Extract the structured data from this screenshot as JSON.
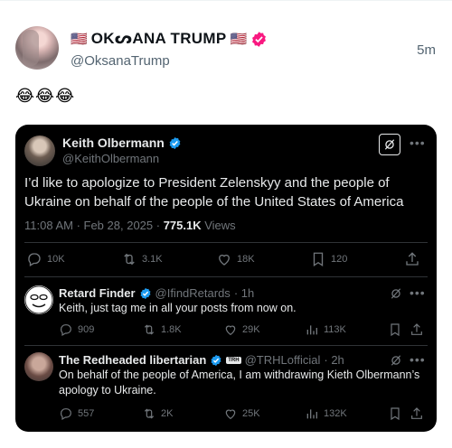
{
  "post": {
    "display_name": "OKᔕANA TRUMP",
    "flag": "🇺🇸",
    "handle": "@OksanaTrump",
    "time": "5m",
    "text": "😂😂😂"
  },
  "quote": {
    "name": "Keith Olbermann",
    "handle": "@KeithOlbermann",
    "text": "I’d like to apologize to President Zelenskyy and the people of Ukraine on behalf of the people of the United States of America",
    "time_date": "11:08 AM · Feb 28, 2025 · ",
    "views_count": "775.1K",
    "views_label": " Views",
    "stats": {
      "replies": "10K",
      "reposts": "3.1K",
      "likes": "18K",
      "bookmarks": "120"
    }
  },
  "replies": [
    {
      "name": "Retard Finder",
      "handle": "@IfindRetards",
      "time": "· 1h",
      "text": "Keith, just tag me in all your posts from now on.",
      "stats": {
        "replies": "909",
        "reposts": "1.8K",
        "likes": "29K",
        "views": "113K"
      }
    },
    {
      "name": "The Redheaded libertarian",
      "badge": "TRH",
      "handle": "@TRHLofficial",
      "time": "· 2h",
      "text": "On behalf of the people of America, I am withdrawing Kieth Olbermann’s apology to Ukraine.",
      "stats": {
        "replies": "557",
        "reposts": "2K",
        "likes": "25K",
        "views": "132K"
      }
    }
  ],
  "colors": {
    "verified_blue": "#1d9bf0",
    "verified_pink": "#f91880",
    "card_bg": "#000000",
    "muted": "#71767b"
  }
}
